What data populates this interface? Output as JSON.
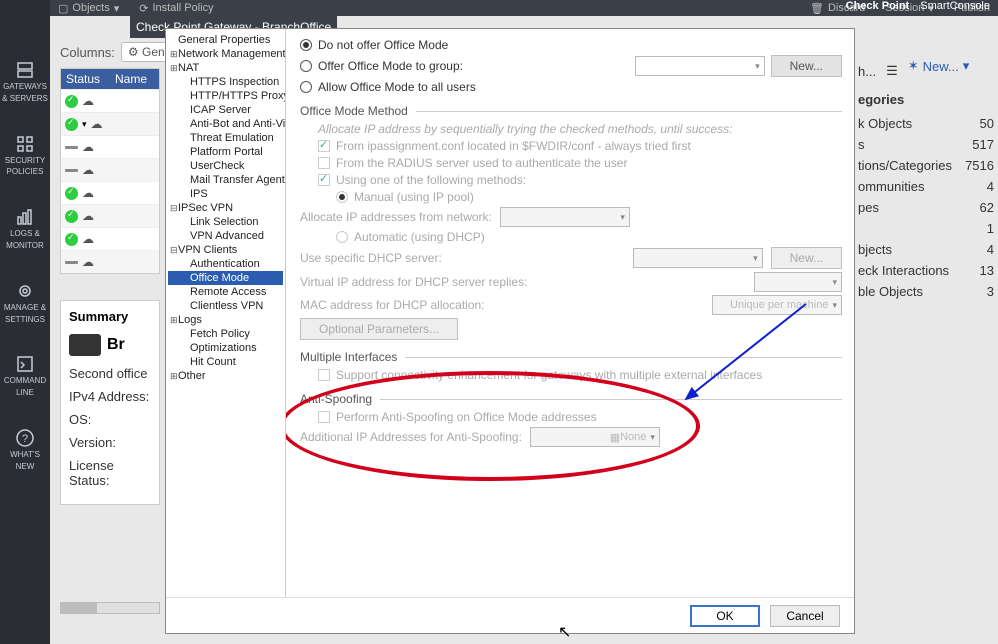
{
  "app": {
    "brand_top": "Check Point",
    "brand_bot": "SmartConsole",
    "dialog_title": "Check Point Gateway - BranchOffice"
  },
  "toolbar": {
    "objects": "Objects",
    "install": "Install Policy",
    "discard": "Discard",
    "session": "Session",
    "publish": "Publish"
  },
  "rail": [
    {
      "id": "gateways",
      "l1": "GATEWAYS",
      "l2": "& SERVERS"
    },
    {
      "id": "policies",
      "l1": "SECURITY",
      "l2": "POLICIES"
    },
    {
      "id": "logs",
      "l1": "LOGS &",
      "l2": "MONITOR"
    },
    {
      "id": "manage",
      "l1": "MANAGE &",
      "l2": "SETTINGS"
    },
    {
      "id": "cmdline",
      "l1": "COMMAND",
      "l2": "LINE"
    },
    {
      "id": "whatsnew",
      "l1": "WHAT'S",
      "l2": "NEW"
    }
  ],
  "columns_label": "Columns:",
  "columns_button": "Gen",
  "search_placeholder": "h...",
  "grid": {
    "h1": "Status",
    "h2": "Name",
    "rows": [
      {
        "status": "green",
        "chev": false
      },
      {
        "status": "green",
        "chev": true
      },
      {
        "status": "dash",
        "chev": false
      },
      {
        "status": "dash",
        "chev": false
      },
      {
        "status": "green",
        "chev": false
      },
      {
        "status": "green",
        "chev": false
      },
      {
        "status": "green",
        "chev": false
      },
      {
        "status": "dash",
        "chev": false
      }
    ]
  },
  "summary": {
    "title": "Summary",
    "name": "Br",
    "desc": "Second office",
    "ip_label": "IPv4 Address:",
    "os_label": "OS:",
    "ver_label": "Version:",
    "lic_label": "License Status:"
  },
  "right": {
    "new": "New...",
    "head": "egories",
    "rows": [
      {
        "k": "k Objects",
        "v": "50"
      },
      {
        "k": "s",
        "v": "517"
      },
      {
        "k": "tions/Categories",
        "v": "7516"
      },
      {
        "k": "ommunities",
        "v": "4"
      },
      {
        "k": "pes",
        "v": "62"
      },
      {
        "k": "",
        "v": "1"
      },
      {
        "k": "bjects",
        "v": "4"
      },
      {
        "k": "eck Interactions",
        "v": "13"
      },
      {
        "k": "ble Objects",
        "v": "3"
      }
    ]
  },
  "tree": [
    {
      "t": "General Properties",
      "lv": 0
    },
    {
      "t": "Network Management",
      "lv": 0,
      "exp": "+"
    },
    {
      "t": "NAT",
      "lv": 0,
      "exp": "+"
    },
    {
      "t": "HTTPS Inspection",
      "lv": 1
    },
    {
      "t": "HTTP/HTTPS Proxy",
      "lv": 1
    },
    {
      "t": "ICAP Server",
      "lv": 1
    },
    {
      "t": "Anti-Bot and Anti-Virus",
      "lv": 1
    },
    {
      "t": "Threat Emulation",
      "lv": 1
    },
    {
      "t": "Platform Portal",
      "lv": 1
    },
    {
      "t": "UserCheck",
      "lv": 1
    },
    {
      "t": "Mail Transfer Agent",
      "lv": 1
    },
    {
      "t": "IPS",
      "lv": 1
    },
    {
      "t": "IPSec VPN",
      "lv": 0,
      "exp": "–"
    },
    {
      "t": "Link Selection",
      "lv": 1
    },
    {
      "t": "VPN Advanced",
      "lv": 1
    },
    {
      "t": "VPN Clients",
      "lv": 0,
      "exp": "–"
    },
    {
      "t": "Authentication",
      "lv": 1
    },
    {
      "t": "Office Mode",
      "lv": 1,
      "sel": true
    },
    {
      "t": "Remote Access",
      "lv": 1
    },
    {
      "t": "Clientless VPN",
      "lv": 1
    },
    {
      "t": "Logs",
      "lv": 0,
      "exp": "+"
    },
    {
      "t": "Fetch Policy",
      "lv": 1
    },
    {
      "t": "Optimizations",
      "lv": 1
    },
    {
      "t": "Hit Count",
      "lv": 1
    },
    {
      "t": "Other",
      "lv": 0,
      "exp": "+"
    }
  ],
  "form": {
    "r1": "Do not offer Office Mode",
    "r2": "Offer Office Mode to group:",
    "r2_new": "New...",
    "r3": "Allow Office Mode to all users",
    "sec_method": "Office Mode Method",
    "method_intro": "Allocate IP address by sequentially trying the checked methods, until success:",
    "c_ipass": "From ipassignment.conf located in $FWDIR/conf - always tried first",
    "c_radius": "From the RADIUS server used to authenticate the user",
    "c_following": "Using one of the following methods:",
    "r_manual": "Manual (using IP pool)",
    "manual_l": "Allocate IP addresses from network:",
    "r_auto": "Automatic (using DHCP)",
    "auto_l": "Use specific DHCP server:",
    "auto_new": "New...",
    "vip_l": "Virtual IP address for DHCP server replies:",
    "mac_l": "MAC address for DHCP allocation:",
    "mac_v": "Unique per machine",
    "opt_params": "Optional Parameters...",
    "sec_multi": "Multiple Interfaces",
    "c_multi": "Support connectivity enhancement for gateways with multiple external interfaces",
    "sec_spoof": "Anti-Spoofing",
    "c_spoof": "Perform Anti-Spoofing on Office Mode addresses",
    "spoof_l": "Additional IP Addresses for Anti-Spoofing:",
    "spoof_v": "None"
  },
  "footer": {
    "ok": "OK",
    "cancel": "Cancel"
  }
}
